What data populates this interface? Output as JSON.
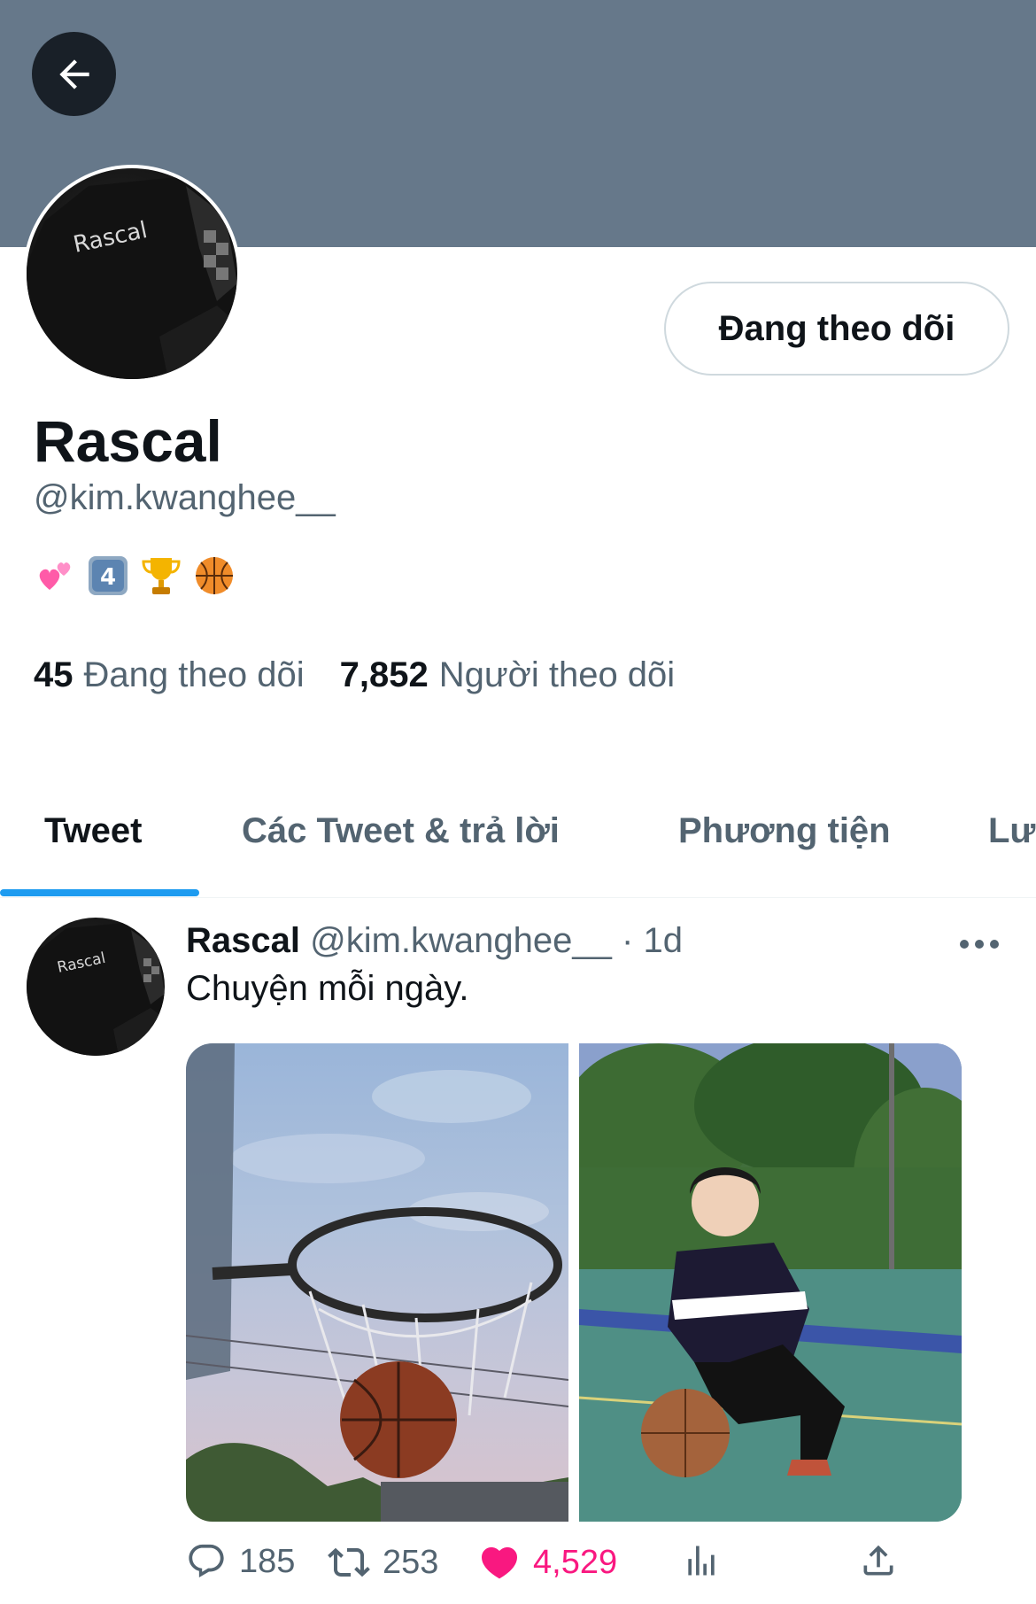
{
  "header": {
    "back_icon": "arrow-left-icon",
    "banner_color": "#66788a"
  },
  "profile": {
    "display_name": "Rascal",
    "handle": "@kim.kwanghee__",
    "follow_button_label": "Đang theo dõi",
    "bio_emojis": [
      "two-hearts-icon",
      "keycap-4-icon",
      "trophy-icon",
      "basketball-icon"
    ],
    "avatar_text": "Rascal"
  },
  "stats": {
    "following_count": "45",
    "following_label": "Đang theo dõi",
    "followers_count": "7,852",
    "followers_label": "Người theo dõi"
  },
  "tabs": [
    {
      "label": "Tweet",
      "active": true
    },
    {
      "label": "Các Tweet & trả lời",
      "active": false
    },
    {
      "label": "Phương tiện",
      "active": false
    },
    {
      "label": "Lượt thích",
      "active": false
    }
  ],
  "tweet": {
    "name": "Rascal",
    "handle": "@kim.kwanghee__",
    "dot": "·",
    "time": "1d",
    "text": "Chuyện mỗi ngày.",
    "avatar_text": "Rascal",
    "media": [
      {
        "description": "basketball-hoop-photo"
      },
      {
        "description": "person-with-basketball-photo"
      }
    ],
    "replies": "185",
    "retweets": "253",
    "likes": "4,529",
    "liked": true,
    "accent_colors": {
      "like": "#f91880",
      "tab_indicator": "#1d9bf0",
      "muted": "#536471"
    }
  }
}
